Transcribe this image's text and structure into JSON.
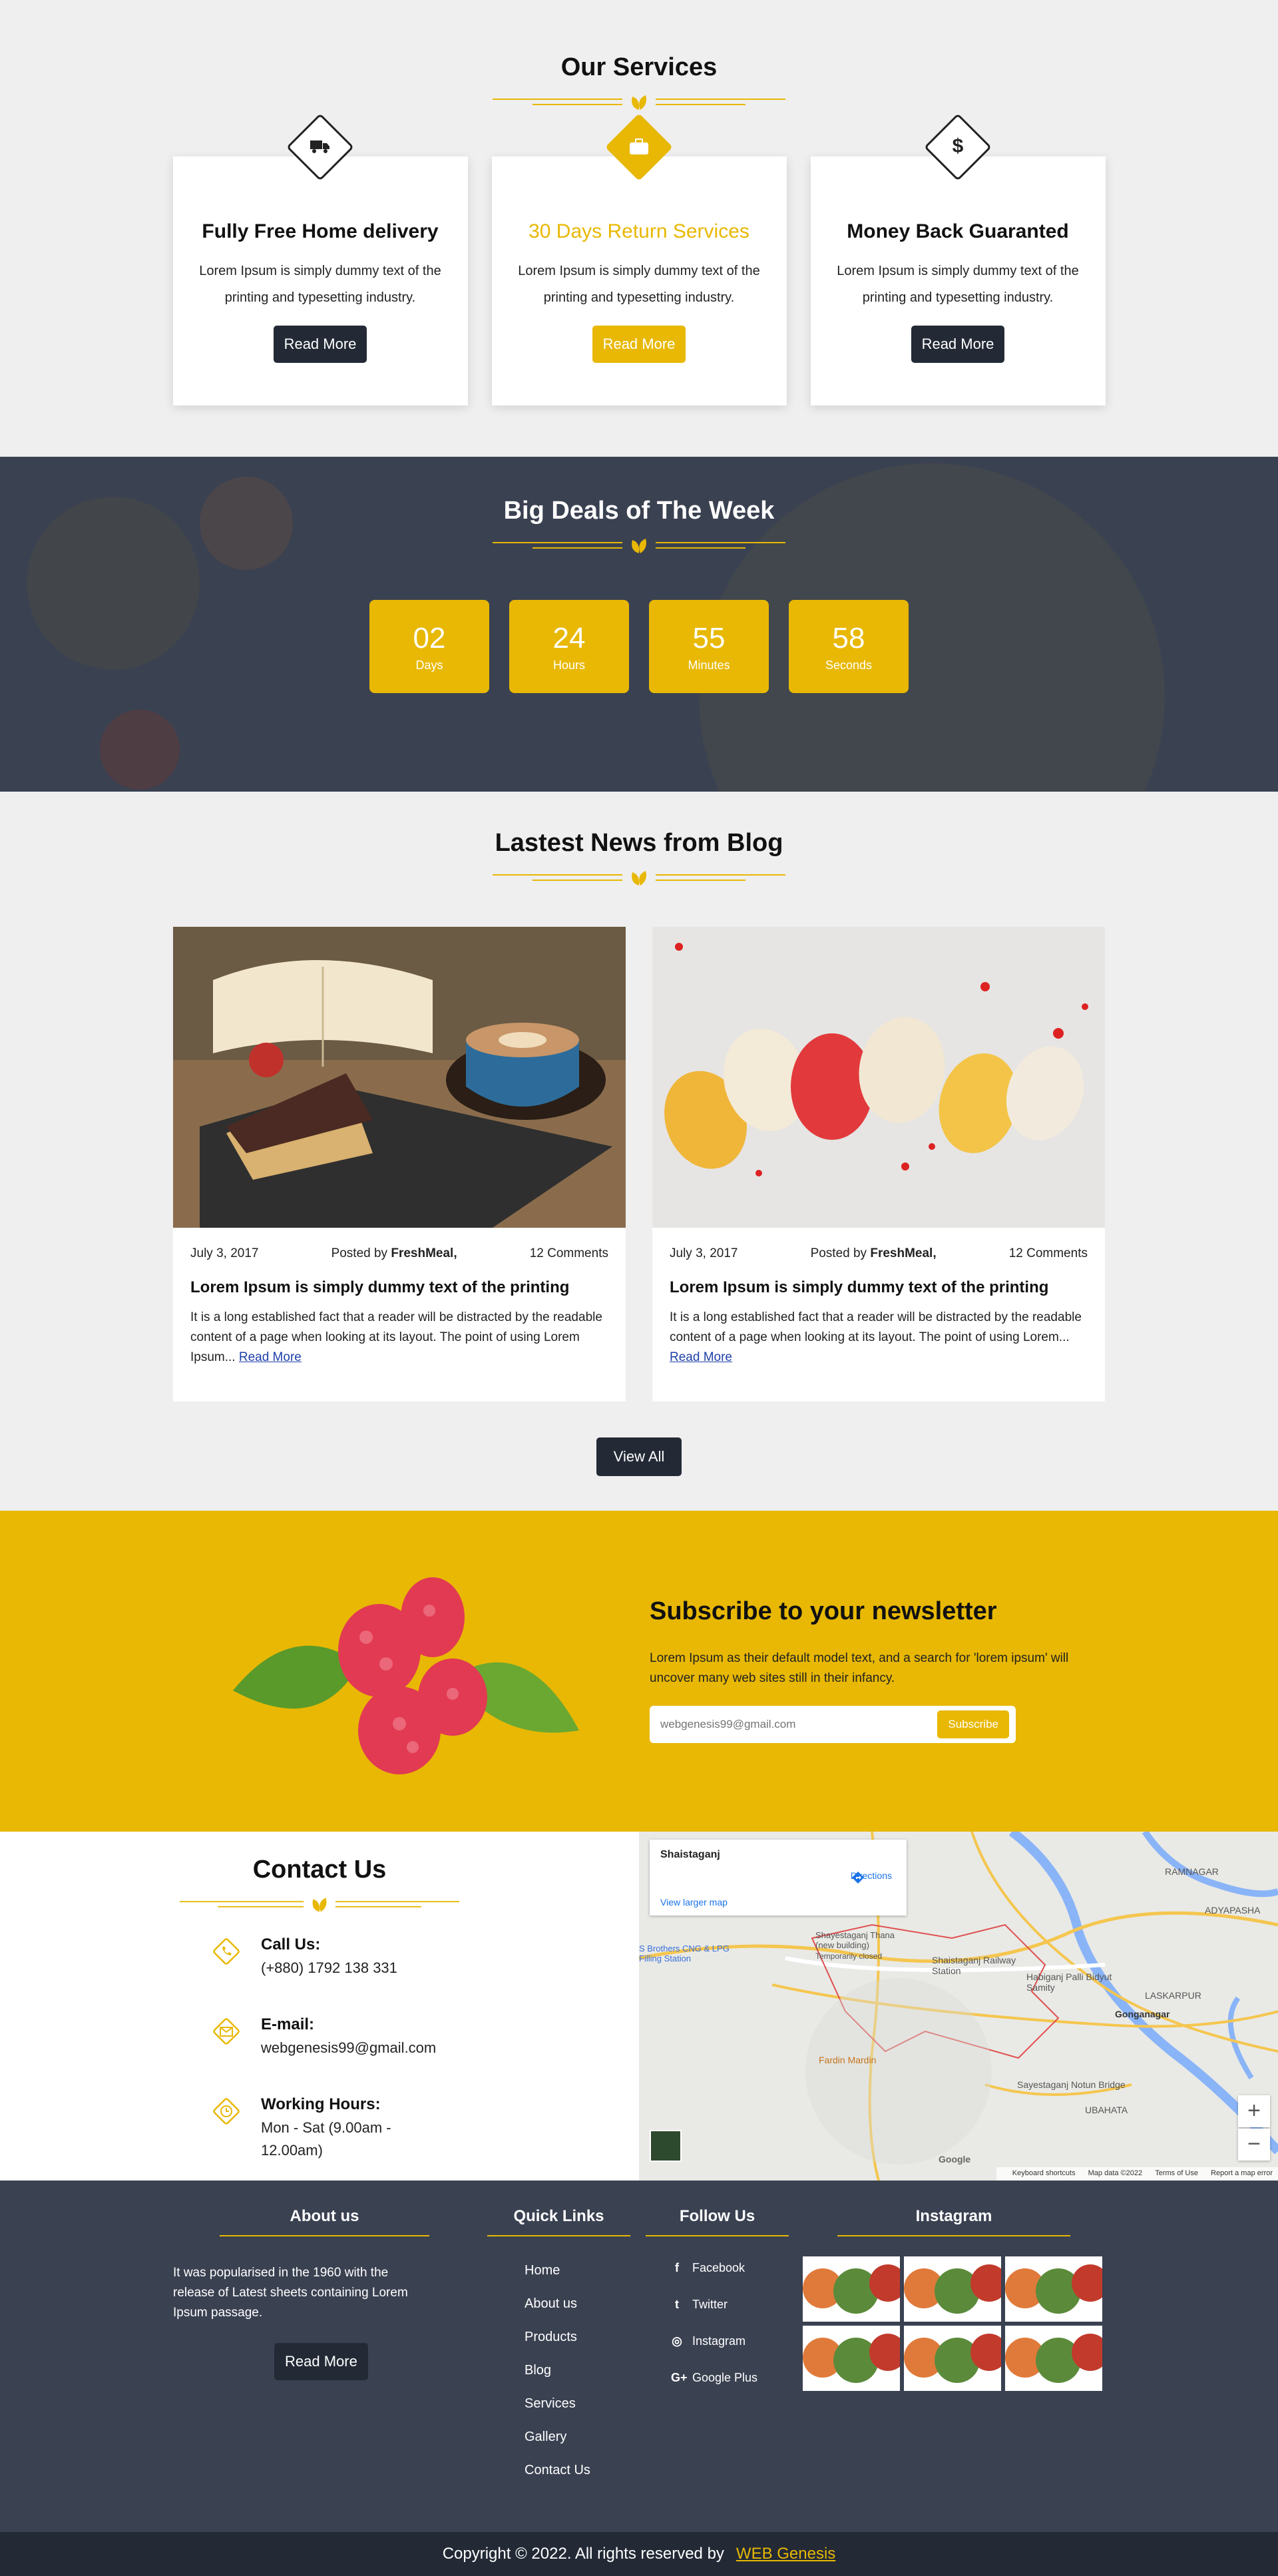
{
  "services": {
    "title": "Our Services",
    "items": [
      {
        "title": "Fully Free Home delivery",
        "text": "Lorem Ipsum is simply dummy text of the printing and typesetting industry.",
        "button": "Read More",
        "icon": "truck-icon"
      },
      {
        "title": "30 Days Return Services",
        "text": "Lorem Ipsum is simply dummy text of the printing and typesetting industry.",
        "button": "Read More",
        "icon": "briefcase-icon"
      },
      {
        "title": "Money Back Guaranted",
        "text": "Lorem Ipsum is simply dummy text of the printing and typesetting industry.",
        "button": "Read More",
        "icon": "dollar-icon"
      }
    ]
  },
  "deals": {
    "title": "Big Deals of The Week",
    "counters": [
      {
        "value": "02",
        "label": "Days"
      },
      {
        "value": "24",
        "label": "Hours"
      },
      {
        "value": "55",
        "label": "Minutes"
      },
      {
        "value": "58",
        "label": "Seconds"
      }
    ]
  },
  "blog": {
    "title": "Lastest News from Blog",
    "posts": [
      {
        "date": "July 3, 2017",
        "posted_by": "Posted by",
        "author": "FreshMeal,",
        "comments": "12 Comments",
        "title": "Lorem Ipsum is simply dummy text of the printing",
        "excerpt": "It is a long established fact that a reader will be distracted by the readable content of a page when looking at its layout. The point of using Lorem Ipsum...",
        "link": "Read More"
      },
      {
        "date": "July 3, 2017",
        "posted_by": "Posted by",
        "author": "FreshMeal,",
        "comments": "12 Comments",
        "title": "Lorem Ipsum is simply dummy text of the printing",
        "excerpt": "It is a long established fact that a reader will be distracted by the readable content of a page when looking at its layout. The point of using Lorem...",
        "link": "Read More"
      }
    ],
    "view_all": "View All"
  },
  "newsletter": {
    "title": "Subscribe to your newsletter",
    "text": "Lorem Ipsum as their default model text, and a search for 'lorem ipsum' will uncover many web sites still in their infancy.",
    "placeholder": "webgenesis99@gmail.com",
    "button": "Subscribe"
  },
  "contact": {
    "title": "Contact Us",
    "call_label": "Call Us:",
    "call_value": "(+880) 1792 138 331",
    "email_label": "E-mail:",
    "email_value": "webgenesis99@gmail.com",
    "hours_label": "Working Hours:",
    "hours_value": "Mon - Sat (9.00am - 12.00am)"
  },
  "map": {
    "place": "Shaistaganj",
    "directions": "Directions",
    "larger": "View larger map",
    "labels": [
      "RAMNAGAR",
      "ADYAPASHA",
      "LASKARPUR",
      "Gonganagar",
      "UBAHATA",
      "Shaistaganj Railway Station",
      "Habiganj Palli Bidyut Samity",
      "Sayestaganj Notun Bridge",
      "Fardin Mardin",
      "Shayestaganj Thana (new building)",
      "Temporarily closed",
      "S Brothers CNG & LPG Filling Station"
    ],
    "footer": [
      "Keyboard shortcuts",
      "Map data ©2022",
      "Terms of Use",
      "Report a map error"
    ],
    "google": "Google",
    "zoom_in": "+",
    "zoom_out": "−"
  },
  "footer": {
    "about_title": "About us",
    "about_text": "It was popularised in the 1960 with the release of Latest sheets containing Lorem Ipsum passage.",
    "about_button": "Read More",
    "links_title": "Quick Links",
    "links": [
      "Home",
      "About us",
      "Products",
      "Blog",
      "Services",
      "Gallery",
      "Contact Us"
    ],
    "follow_title": "Follow Us",
    "follow": [
      {
        "icon": "f",
        "label": "Facebook"
      },
      {
        "icon": "t",
        "label": "Twitter"
      },
      {
        "icon": "◎",
        "label": "Instagram"
      },
      {
        "icon": "G+",
        "label": "Google Plus"
      }
    ],
    "insta_title": "Instagram"
  },
  "copyright": {
    "text": "Copyright © 2022. All rights reserved by",
    "brand": "WEB Genesis"
  },
  "colors": {
    "accent": "#e8b804",
    "dark": "#232a36",
    "slate": "#3a4151"
  }
}
